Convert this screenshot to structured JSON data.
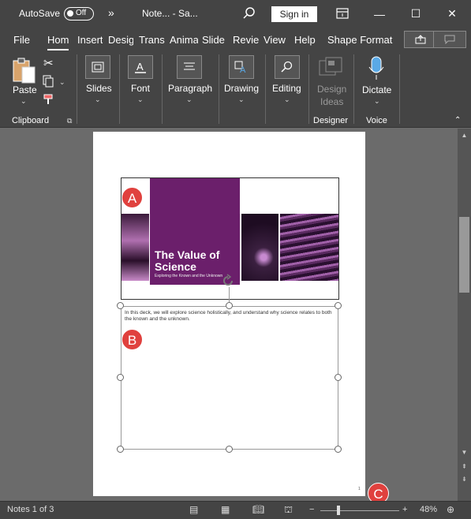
{
  "titlebar": {
    "autosave_label": "AutoSave",
    "autosave_state": "Off",
    "more_glyph": "»",
    "doc_title": "Note... - Sa...",
    "search_icon": "search-icon",
    "signin_label": "Sign in",
    "minimize_glyph": "—",
    "maximize_glyph": "☐",
    "close_glyph": "✕"
  },
  "tabs": {
    "items": [
      "File",
      "Hom",
      "Insert",
      "Desig",
      "Trans",
      "Anima",
      "Slide",
      "Revie",
      "View",
      "Help",
      "Shape Format"
    ],
    "active": "Hom"
  },
  "ribbon": {
    "paste_label": "Paste",
    "clipboard_group": "Clipboard",
    "slides_label": "Slides",
    "font_label": "Font",
    "paragraph_label": "Paragraph",
    "drawing_label": "Drawing",
    "editing_label": "Editing",
    "design_ideas_line1": "Design",
    "design_ideas_line2": "Ideas",
    "designer_group": "Designer",
    "dictate_label": "Dictate",
    "voice_group": "Voice"
  },
  "slide": {
    "title_line1": "The Value of",
    "title_line2": "Science",
    "subtitle": "Exploring the Known and the Unknown"
  },
  "notes": {
    "text": "In this deck, we will explore science holistically, and understand why science relates to both the known and the unknown."
  },
  "page_number": "1",
  "badges": {
    "a": "A",
    "b": "B",
    "c": "C"
  },
  "status": {
    "notes_count": "Notes 1 of 3",
    "zoom_minus": "−",
    "zoom_plus": "+",
    "zoom_level": "48%"
  },
  "colors": {
    "accent_purple": "#6b1f6b",
    "badge_red": "#e0413e",
    "chrome_dark": "#444444"
  }
}
